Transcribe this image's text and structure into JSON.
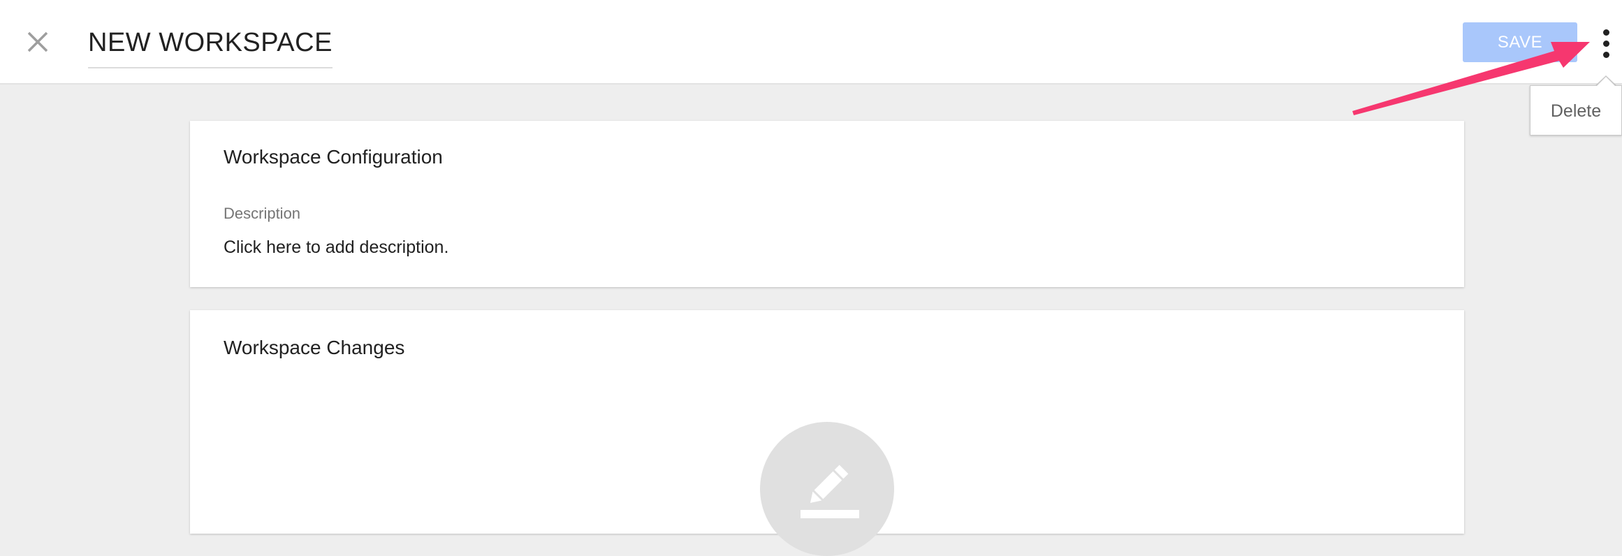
{
  "header": {
    "close_icon": "close-icon",
    "title": "NEW WORKSPACE",
    "save_label": "SAVE",
    "more_icon": "more-vert-icon",
    "save_color": "#a9c7fb"
  },
  "menu": {
    "items": [
      {
        "label": "Delete"
      }
    ]
  },
  "config_card": {
    "title": "Workspace Configuration",
    "description_label": "Description",
    "description_value": "Click here to add description."
  },
  "changes_card": {
    "title": "Workspace Changes",
    "empty_icon": "edit-pencil-icon"
  },
  "annotation": {
    "arrow_color": "#f6376f"
  }
}
